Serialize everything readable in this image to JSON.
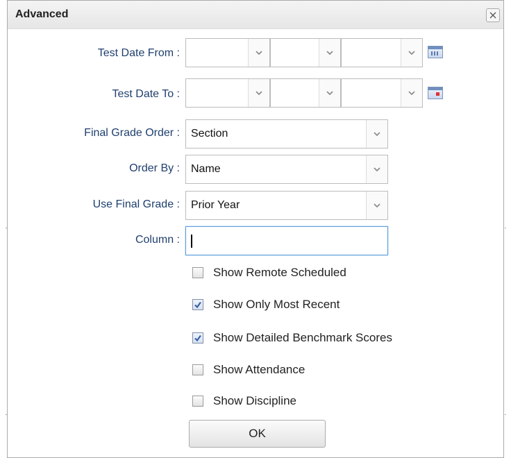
{
  "dialog": {
    "title": "Advanced",
    "close_icon": "close-icon"
  },
  "fields": {
    "test_date_from": {
      "label": "Test Date From :",
      "month": "",
      "day": "",
      "year": "",
      "calendar_icon": "calendar-icon"
    },
    "test_date_to": {
      "label": "Test Date To :",
      "month": "",
      "day": "",
      "year": "",
      "calendar_icon": "calendar-icon"
    },
    "final_grade_order": {
      "label": "Final Grade Order :",
      "value": "Section"
    },
    "order_by": {
      "label": "Order By :",
      "value": "Name"
    },
    "use_final_grade": {
      "label": "Use Final Grade :",
      "value": "Prior Year"
    },
    "column": {
      "label": "Column :",
      "value": ""
    }
  },
  "checkboxes": [
    {
      "label": "Show Remote Scheduled",
      "checked": false
    },
    {
      "label": "Show Only Most Recent",
      "checked": true
    },
    {
      "label": "Show Detailed Benchmark Scores",
      "checked": true
    },
    {
      "label": "Show Attendance",
      "checked": false
    },
    {
      "label": "Show Discipline",
      "checked": false
    }
  ],
  "ok_button": {
    "label": "OK"
  },
  "colors": {
    "label_text": "#1f3f6e",
    "focus_border": "#5b9dd9",
    "check_mark": "#3a62a8"
  }
}
